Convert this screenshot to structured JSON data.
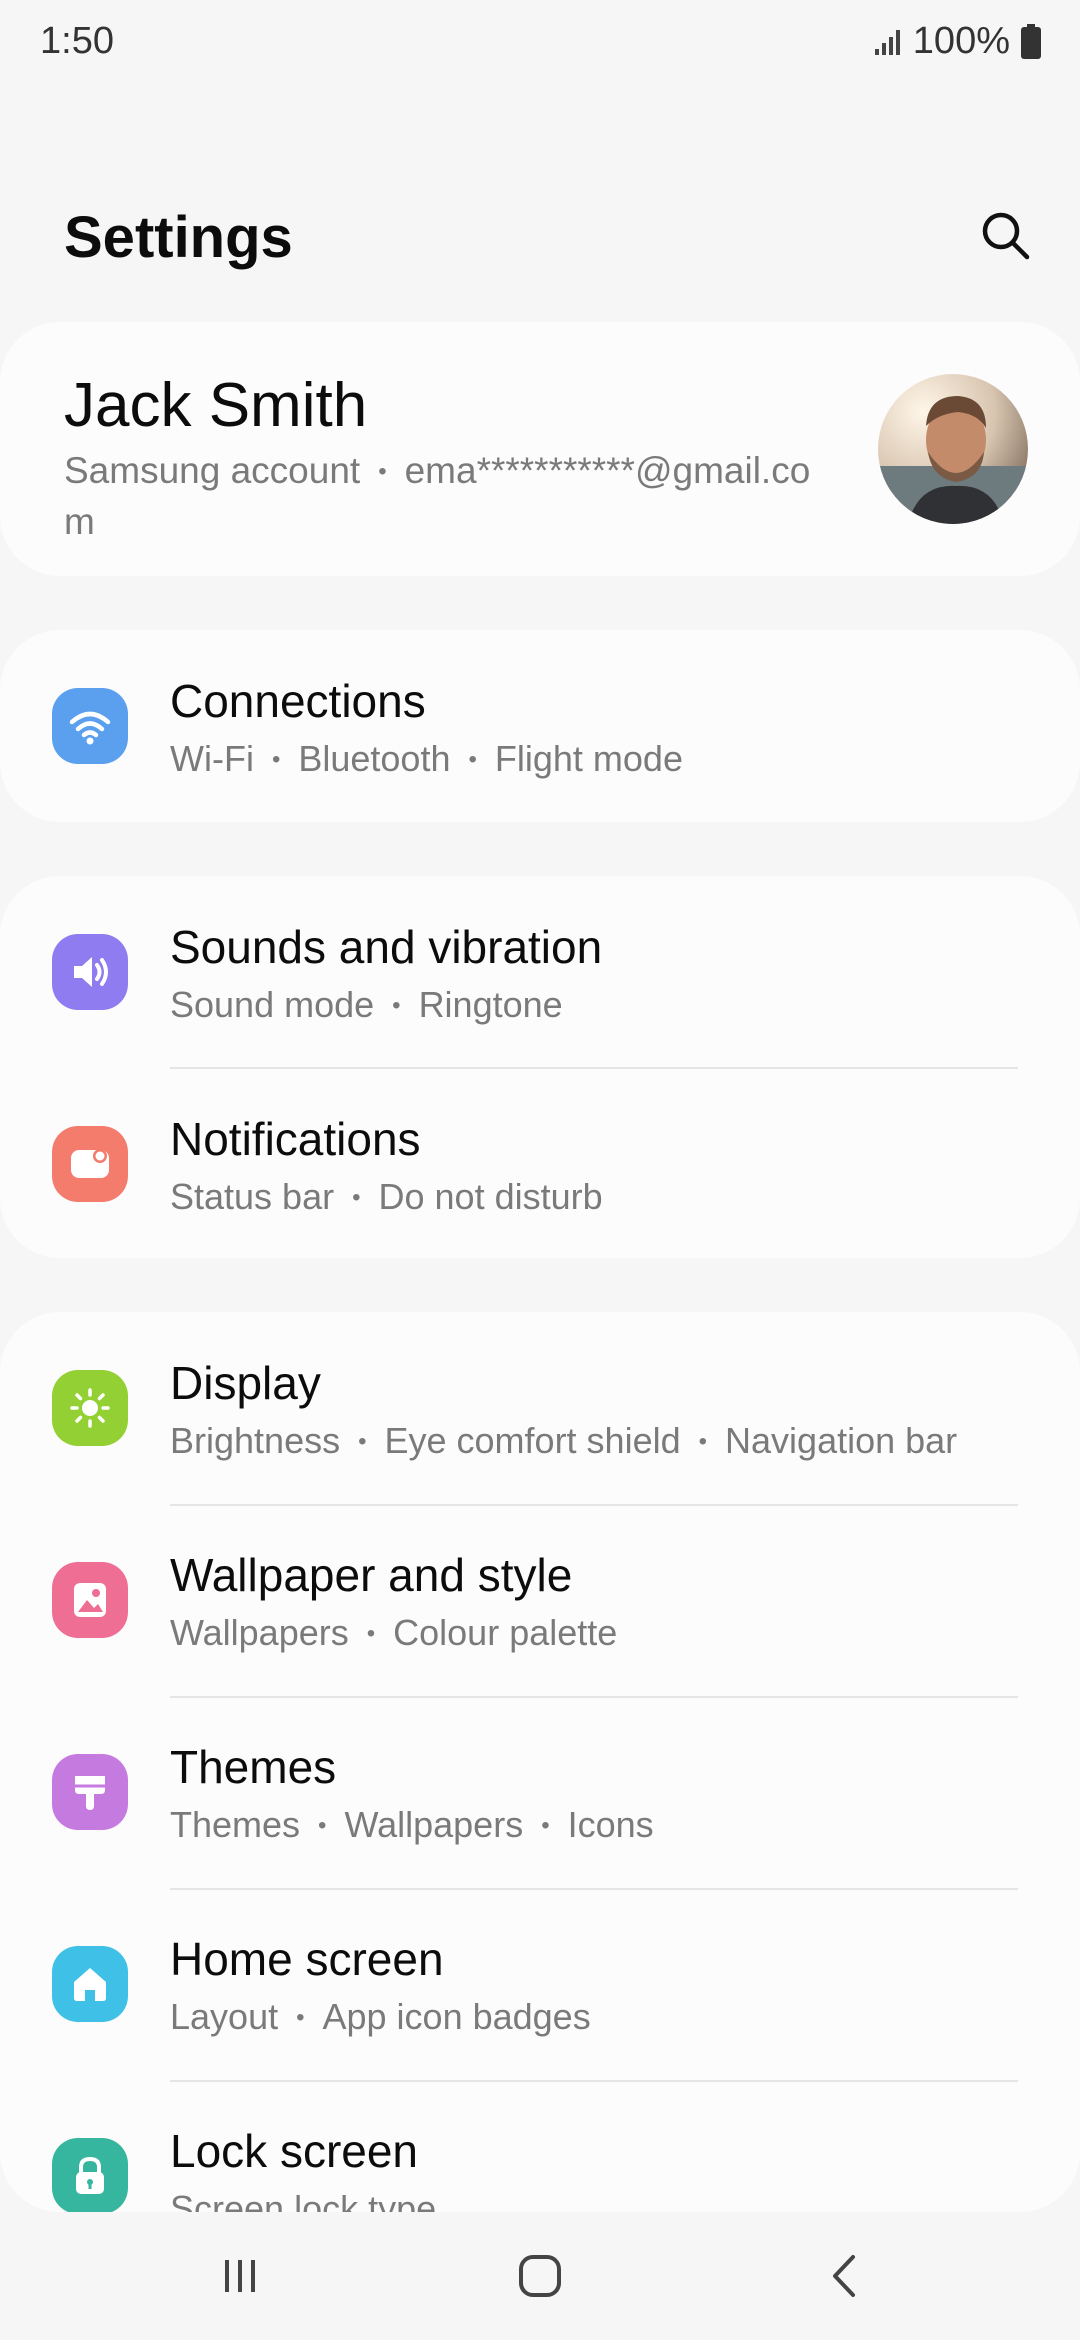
{
  "status_bar": {
    "time": "1:50",
    "battery": "100%"
  },
  "header": {
    "title": "Settings",
    "search_icon": "search-icon"
  },
  "account": {
    "name": "Jack Smith",
    "subtitle_label": "Samsung account",
    "email": "ema***********@gmail.com"
  },
  "items": [
    {
      "title": "Connections",
      "sub": [
        "Wi-Fi",
        "Bluetooth",
        "Flight mode"
      ],
      "icon": "wifi-icon",
      "color": "#5aa0ee"
    },
    {
      "title": "Sounds and vibration",
      "sub": [
        "Sound mode",
        "Ringtone"
      ],
      "icon": "volume-icon",
      "color": "#8e7cf0"
    },
    {
      "title": "Notifications",
      "sub": [
        "Status bar",
        "Do not disturb"
      ],
      "icon": "notifications-icon",
      "color": "#f47c6c"
    },
    {
      "title": "Display",
      "sub": [
        "Brightness",
        "Eye comfort shield",
        "Navigation bar"
      ],
      "icon": "sun-icon",
      "color": "#92d034"
    },
    {
      "title": "Wallpaper and style",
      "sub": [
        "Wallpapers",
        "Colour palette"
      ],
      "icon": "image-icon",
      "color": "#ee6f93"
    },
    {
      "title": "Themes",
      "sub": [
        "Themes",
        "Wallpapers",
        "Icons"
      ],
      "icon": "brush-icon",
      "color": "#c57ae0"
    },
    {
      "title": "Home screen",
      "sub": [
        "Layout",
        "App icon badges"
      ],
      "icon": "home-icon",
      "color": "#3fc0e6"
    },
    {
      "title": "Lock screen",
      "sub": [
        "Screen lock type"
      ],
      "icon": "lock-icon",
      "color": "#37b69f"
    }
  ],
  "nav": {
    "recents_icon": "recents-icon",
    "home_icon": "home-button-icon",
    "back_icon": "back-icon"
  }
}
